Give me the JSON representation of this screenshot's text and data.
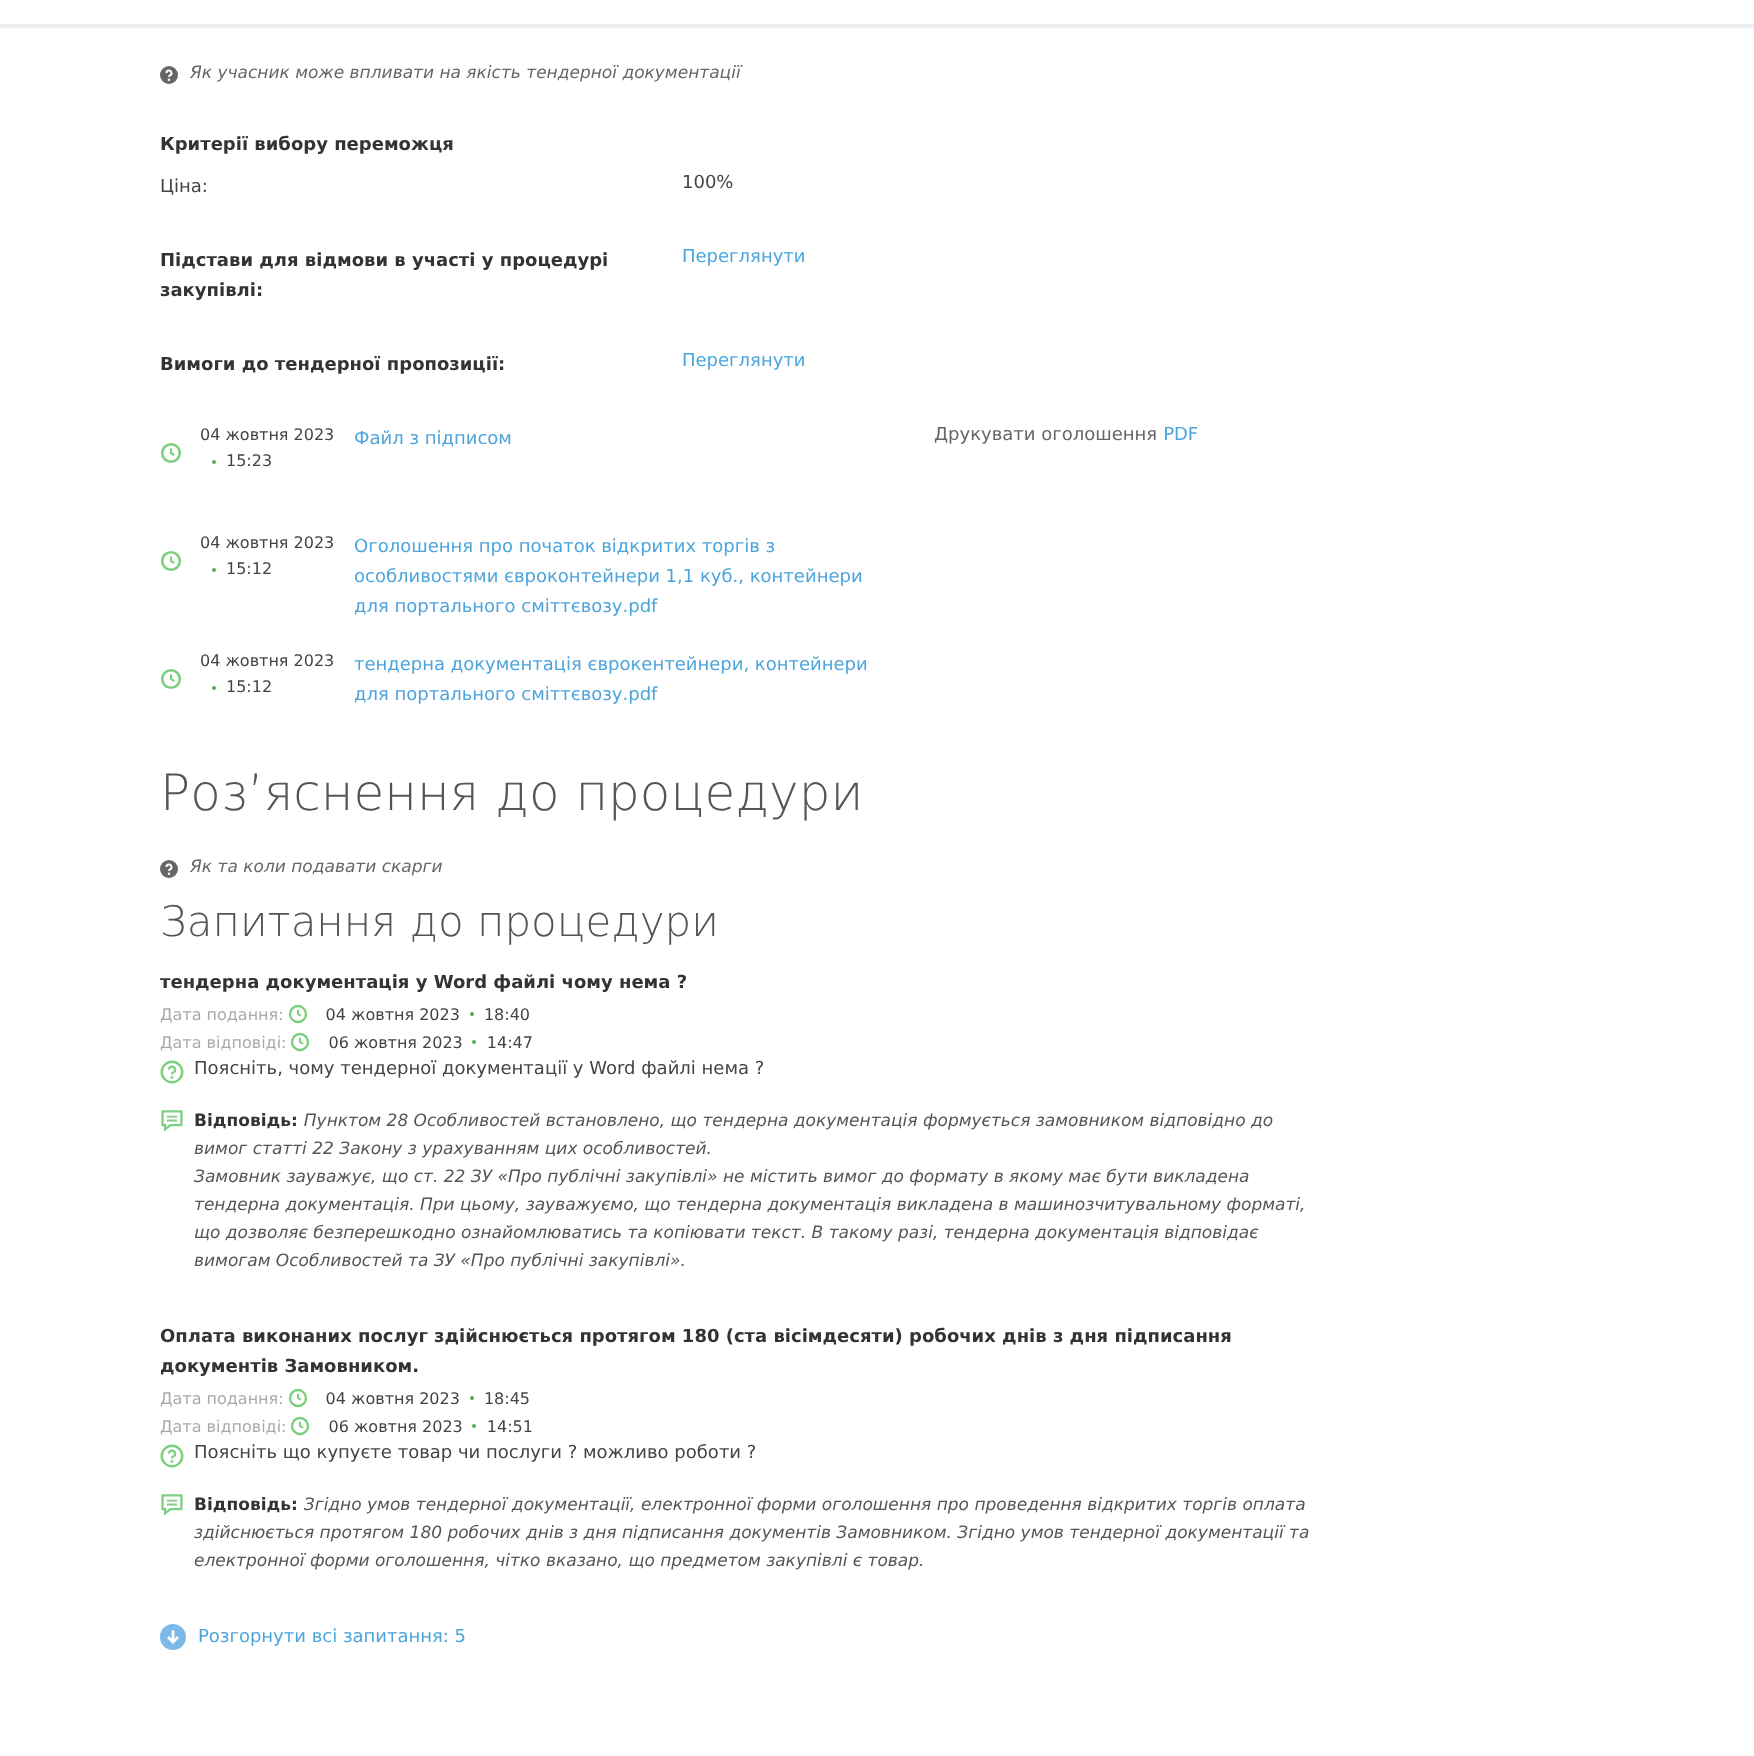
{
  "quality_help_link": "Як учасник може впливати на якість тендерної документації",
  "criteria": {
    "title": "Критерії вибору переможця",
    "rows": [
      {
        "label": "Ціна:",
        "value": "100%"
      }
    ]
  },
  "info_rows": [
    {
      "label": "Підстави для відмови в участі у процедурі закупівлі:",
      "link": "Переглянути"
    },
    {
      "label": "Вимоги до тендерної пропозиції:",
      "link": "Переглянути"
    }
  ],
  "documents": [
    {
      "date": "04 жовтня 2023",
      "time": "15:23",
      "title": "Файл з підписом",
      "print_label": "Друкувати оголошення",
      "print_link": "PDF"
    },
    {
      "date": "04 жовтня 2023",
      "time": "15:12",
      "title": "Оголошення про початок відкритих торгів з особливостями євроконтейнери 1,1 куб., контейнери для портального сміттєвозу.pdf"
    },
    {
      "date": "04 жовтня 2023",
      "time": "15:12",
      "title": "тендерна документація єврокентейнери, контейнери для портального сміттєвозу.pdf"
    }
  ],
  "clarifications_title": "Роз’яснення до процедури",
  "complaints_help_link": "Як та коли подавати скарги",
  "questions_title": "Запитання до процедури",
  "questions": [
    {
      "title": "тендерна документація у Word файлі чому нема ?",
      "submitted_label": "Дата подання:",
      "submitted_date": "04 жовтня 2023",
      "submitted_time": "18:40",
      "answered_label": "Дата відповіді:",
      "answered_date": "06 жовтня 2023",
      "answered_time": "14:47",
      "question": "Поясніть, чому тендерної документації у Word файлі нема ?",
      "answer_label": "Відповідь:",
      "answer": [
        "Пунктом 28 Особливостей встановлено, що тендерна документація формується замовником відповідно до вимог статті 22 Закону з урахуванням цих особливостей.",
        "Замовник зауважує, що ст. 22 ЗУ «Про публічні закупівлі» не містить вимог до формату в якому має бути викладена тендерна документація. При цьому, зауважуємо, що тендерна документація викладена в машинозчитувальному форматі, що дозволяє безперешкодно ознайомлюватись та копіювати текст. В такому разі, тендерна документація відповідає вимогам Особливостей та ЗУ «Про публічні закупівлі»."
      ]
    },
    {
      "title": "Оплата виконаних послуг здійснюється протягом 180 (ста вісімдесяти) робочих днів з дня підписання документів Замовником.",
      "submitted_label": "Дата подання:",
      "submitted_date": "04 жовтня 2023",
      "submitted_time": "18:45",
      "answered_label": "Дата відповіді:",
      "answered_date": "06 жовтня 2023",
      "answered_time": "14:51",
      "question": "Поясніть що купуєте товар чи послуги ? можливо роботи ?",
      "answer_label": "Відповідь:",
      "answer": [
        "Згідно умов тендерної документації, електронної форми оголошення про проведення відкритих торгів оплата здійснюється протягом 180 робочих днів з дня підписання документів Замовником. Згідно умов тендерної документації та електронної форми оголошення, чітко вказано, що предметом закупівлі є товар."
      ]
    }
  ],
  "expand_link": "Розгорнути всі запитання: 5"
}
